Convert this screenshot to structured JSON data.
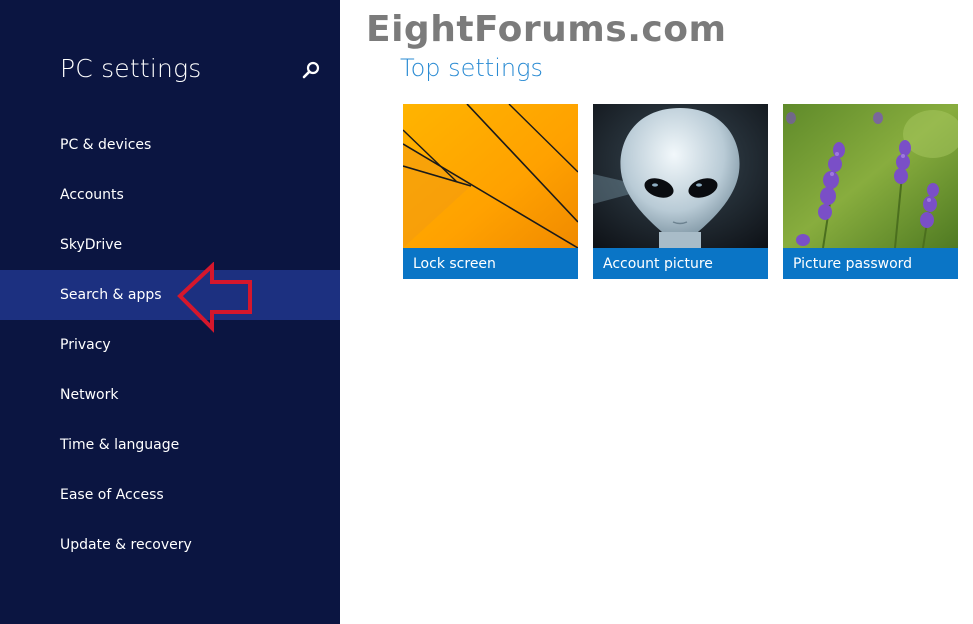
{
  "watermark": "EightForums.com",
  "sidebar": {
    "title": "PC settings",
    "search_icon": "search-icon",
    "items": [
      {
        "label": "PC & devices"
      },
      {
        "label": "Accounts"
      },
      {
        "label": "SkyDrive"
      },
      {
        "label": "Search & apps",
        "selected": true
      },
      {
        "label": "Privacy"
      },
      {
        "label": "Network"
      },
      {
        "label": "Time & language"
      },
      {
        "label": "Ease of Access"
      },
      {
        "label": "Update & recovery"
      }
    ]
  },
  "main": {
    "section_title": "Top settings",
    "tiles": [
      {
        "label": "Lock screen",
        "image": "orange-lines-wallpaper"
      },
      {
        "label": "Account picture",
        "image": "alien-portrait"
      },
      {
        "label": "Picture password",
        "image": "lavender-flowers"
      }
    ]
  },
  "colors": {
    "sidebar_bg": "#0b1541",
    "selected_bg": "#1c3080",
    "accent": "#2a8bd3",
    "tile_label_bg": "#0a75c6",
    "annotation_arrow": "#d5172c"
  }
}
